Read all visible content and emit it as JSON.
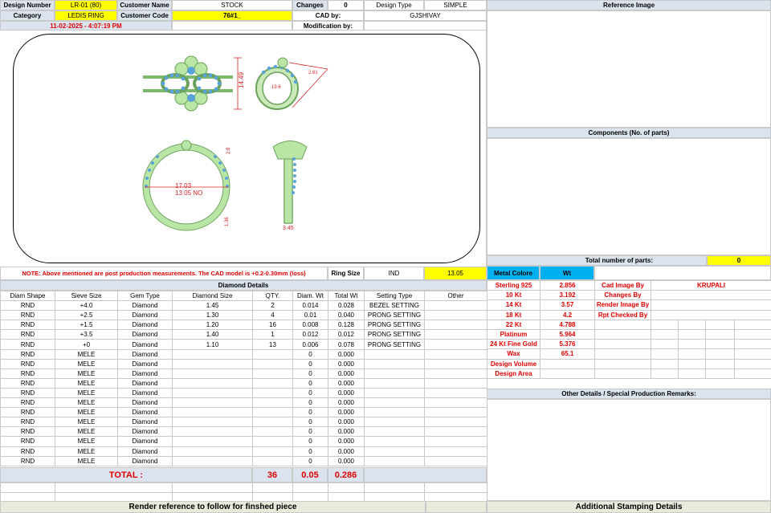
{
  "header": {
    "design_number_label": "Design Number",
    "design_number": "LR-01 (80)",
    "customer_name_label": "Customer Name",
    "customer_name": "STOCK",
    "changes_label": "Changes",
    "changes": "0",
    "design_type_label": "Design Type",
    "design_type": "SIMPLE",
    "category_label": "Category",
    "category": "LEDIS RING",
    "customer_code_label": "Customer Code",
    "customer_code": "76#1_",
    "cad_by_label": "CAD by:",
    "cad_by": "GJSHIVAY",
    "timestamp": "11-02-2025 - 4:07:19 PM",
    "modification_label": "Modification by:"
  },
  "drawing": {
    "dim_height": "14.49",
    "dim_inner_1": "17.03",
    "dim_inner_2": "13.05 NO",
    "dim_band_1": "1.36",
    "dim_band_2": "3.45",
    "dim_top": "2.8",
    "dim_side_1": "19.6",
    "dim_side_2": "2.61"
  },
  "note": {
    "text": "NOTE: Above mentioned are post production measurements. The CAD model is +0.2-0.30mm (loss)",
    "ring_size_label": "Ring Size",
    "ring_size_std": "IND",
    "ring_size_value": "13.05"
  },
  "right_panel": {
    "reference_image_title": "Reference Image",
    "components_title": "Components (No. of parts)",
    "total_parts_label": "Total number of parts:",
    "total_parts_value": "0",
    "metal_colore_label": "Metal Colore",
    "wt_label": "Wt",
    "other_details_title": "Other Details / Special Production Remarks:",
    "stamping_title": "Additional Stamping Details"
  },
  "metals": [
    {
      "name": "Sterling 925",
      "wt": "2.856"
    },
    {
      "name": "10 Kt",
      "wt": "3.192"
    },
    {
      "name": "14 Kt",
      "wt": "3.57"
    },
    {
      "name": "18 Kt",
      "wt": "4.2"
    },
    {
      "name": "22 Kt",
      "wt": "4.788"
    },
    {
      "name": "Platinum",
      "wt": "5.964"
    },
    {
      "name": "24 Kt Fine Gold",
      "wt": "5.376"
    },
    {
      "name": "Wax",
      "wt": "65.1"
    },
    {
      "name": "Design Volume",
      "wt": ""
    },
    {
      "name": "Design Area",
      "wt": ""
    }
  ],
  "credits": [
    {
      "label": "Cad Image By",
      "value": "KRUPALI"
    },
    {
      "label": "Changes By",
      "value": ""
    },
    {
      "label": "Render Image By",
      "value": ""
    },
    {
      "label": "Rpt Checked By",
      "value": ""
    }
  ],
  "diamonds": {
    "title": "Diamond Details",
    "columns": [
      "Diam Shape",
      "Sieve Size",
      "Gem Type",
      "Diamond Size",
      "QTY.",
      "Diam. Wt",
      "Total Wt",
      "Setting Type",
      "Other"
    ],
    "rows": [
      [
        "RND",
        "+4.0",
        "Diamond",
        "1.45",
        "2",
        "0.014",
        "0.028",
        "BEZEL SETTING",
        ""
      ],
      [
        "RND",
        "+2.5",
        "Diamond",
        "1.30",
        "4",
        "0.01",
        "0.040",
        "PRONG SETTING",
        ""
      ],
      [
        "RND",
        "+1.5",
        "Diamond",
        "1.20",
        "16",
        "0.008",
        "0.128",
        "PRONG SETTING",
        ""
      ],
      [
        "RND",
        "+3.5",
        "Diamond",
        "1.40",
        "1",
        "0.012",
        "0.012",
        "PRONG SETTING",
        ""
      ],
      [
        "RND",
        "+0",
        "Diamond",
        "1.10",
        "13",
        "0.006",
        "0.078",
        "PRONG SETTING",
        ""
      ],
      [
        "RND",
        "MELE",
        "Diamond",
        "",
        "",
        "0",
        "0.000",
        "",
        ""
      ],
      [
        "RND",
        "MELE",
        "Diamond",
        "",
        "",
        "0",
        "0.000",
        "",
        ""
      ],
      [
        "RND",
        "MELE",
        "Diamond",
        "",
        "",
        "0",
        "0.000",
        "",
        ""
      ],
      [
        "RND",
        "MELE",
        "Diamond",
        "",
        "",
        "0",
        "0.000",
        "",
        ""
      ],
      [
        "RND",
        "MELE",
        "Diamond",
        "",
        "",
        "0",
        "0.000",
        "",
        ""
      ],
      [
        "RND",
        "MELE",
        "Diamond",
        "",
        "",
        "0",
        "0.000",
        "",
        ""
      ],
      [
        "RND",
        "MELE",
        "Diamond",
        "",
        "",
        "0",
        "0.000",
        "",
        ""
      ],
      [
        "RND",
        "MELE",
        "Diamond",
        "",
        "",
        "0",
        "0.000",
        "",
        ""
      ],
      [
        "RND",
        "MELE",
        "Diamond",
        "",
        "",
        "0",
        "0.000",
        "",
        ""
      ],
      [
        "RND",
        "MELE",
        "Diamond",
        "",
        "",
        "0",
        "0.000",
        "",
        ""
      ],
      [
        "RND",
        "MELE",
        "Diamond",
        "",
        "",
        "0",
        "0.000",
        "",
        ""
      ],
      [
        "RND",
        "MELE",
        "Diamond",
        "",
        "",
        "0",
        "0.000",
        "",
        ""
      ]
    ],
    "total_label": "TOTAL :",
    "total_qty": "36",
    "total_diam_wt": "0.05",
    "total_wt": "0.286"
  },
  "footer": {
    "render_reference": "Render reference to follow for finshed piece"
  },
  "colors": {
    "label_bg": "#dbe3ef",
    "highlight": "#ffff00",
    "accent_blue": "#00b0f0",
    "alert_red": "#e10000",
    "metal_green": "#b9e6a4",
    "stone_blue": "#5aa3d8"
  }
}
